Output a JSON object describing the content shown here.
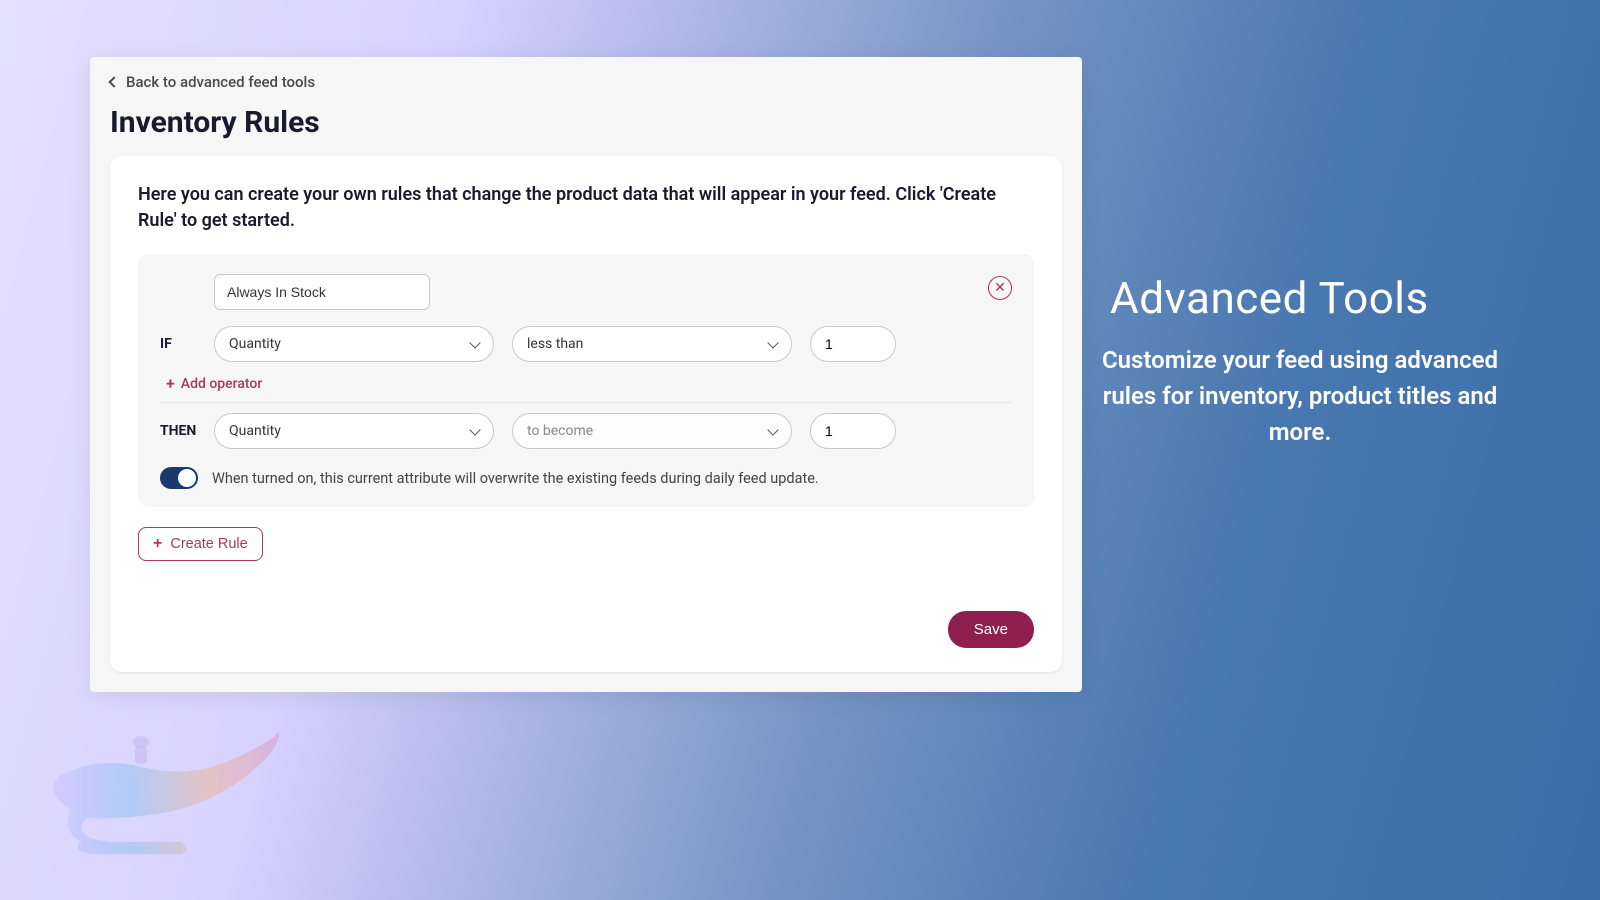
{
  "nav": {
    "back_label": "Back to advanced feed tools"
  },
  "page": {
    "title": "Inventory Rules"
  },
  "card": {
    "description": "Here you can create your own rules that change the product data that will appear in your feed. Click 'Create Rule' to get started."
  },
  "rule": {
    "name": "Always In Stock",
    "if_label": "IF",
    "if_field": "Quantity",
    "if_operator": "less than",
    "if_value": "1",
    "add_operator_label": "Add operator",
    "then_label": "THEN",
    "then_field": "Quantity",
    "then_operator": "to become",
    "then_value": "1",
    "toggle_text": "When turned on, this current attribute will overwrite the existing feeds during daily feed update."
  },
  "buttons": {
    "create_rule": "Create Rule",
    "save": "Save"
  },
  "promo": {
    "title": "Advanced Tools",
    "subtitle": "Customize your feed using advanced rules for inventory, product titles and more."
  }
}
